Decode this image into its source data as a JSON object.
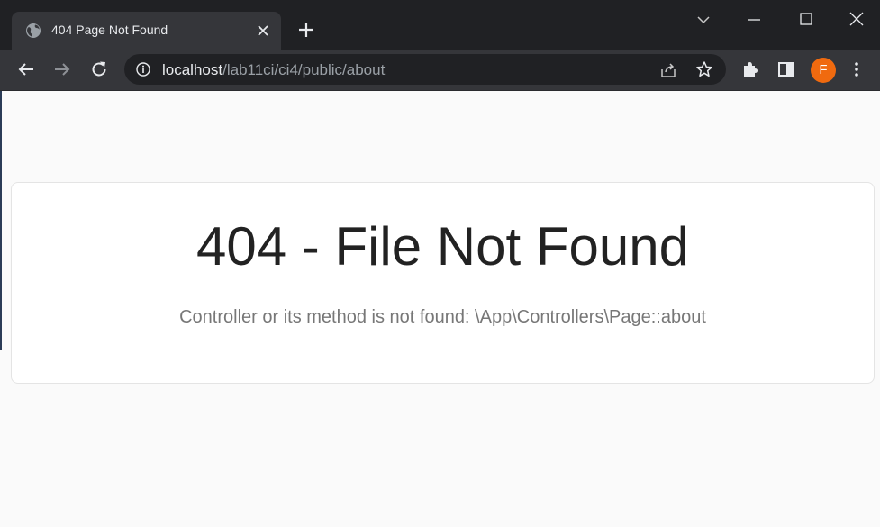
{
  "browser": {
    "tab_title": "404 Page Not Found",
    "url_host": "localhost",
    "url_path": "/lab11ci/ci4/public/about",
    "profile_initial": "F",
    "profile_color": "#f06a0f"
  },
  "page": {
    "heading": "404 - File Not Found",
    "message": "Controller or its method is not found: \\App\\Controllers\\Page::about"
  }
}
